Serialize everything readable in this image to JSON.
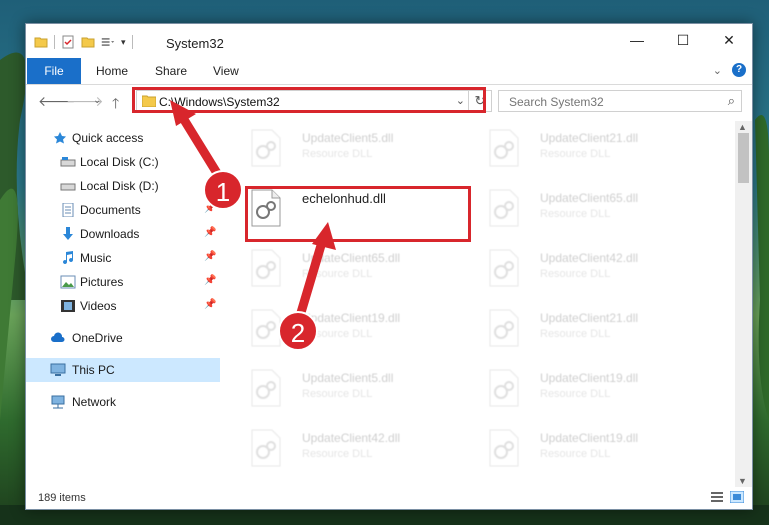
{
  "window": {
    "title": "System32",
    "controls": {
      "minimize": "—",
      "maximize": "☐",
      "close": "✕"
    }
  },
  "ribbon": {
    "tabs": [
      "File",
      "Home",
      "Share",
      "View"
    ],
    "help": "?"
  },
  "address": {
    "path": "C:\\Windows\\System32",
    "search_placeholder": "Search System32"
  },
  "sidebar": {
    "items": [
      {
        "label": "Quick access",
        "icon": "star-icon"
      },
      {
        "label": "Local Disk (C:)",
        "icon": "drive-icon"
      },
      {
        "label": "Local Disk (D:)",
        "icon": "drive-icon"
      },
      {
        "label": "Documents",
        "icon": "documents-icon",
        "pinned": true
      },
      {
        "label": "Downloads",
        "icon": "download-icon",
        "pinned": true
      },
      {
        "label": "Music",
        "icon": "music-icon",
        "pinned": true
      },
      {
        "label": "Pictures",
        "icon": "pictures-icon",
        "pinned": true
      },
      {
        "label": "Videos",
        "icon": "videos-icon",
        "pinned": true
      },
      {
        "label": "OneDrive",
        "icon": "cloud-icon"
      },
      {
        "label": "This PC",
        "icon": "computer-icon",
        "selected": true
      },
      {
        "label": "Network",
        "icon": "network-icon"
      }
    ]
  },
  "files": [
    {
      "name": "UpdateClient5.dll",
      "type": "Resource DLL"
    },
    {
      "name": "UpdateClient21.dll",
      "type": "Resource DLL"
    },
    {
      "name": "echelonhud.dll",
      "type": ""
    },
    {
      "name": "UpdateClient65.dll",
      "type": "Resource DLL"
    },
    {
      "name": "UpdateClient65.dll",
      "type": "Resource DLL"
    },
    {
      "name": "UpdateClient42.dll",
      "type": "Resource DLL"
    },
    {
      "name": "UpdateClient19.dll",
      "type": "Resource DLL"
    },
    {
      "name": "UpdateClient21.dll",
      "type": "Resource DLL"
    },
    {
      "name": "UpdateClient5.dll",
      "type": "Resource DLL"
    },
    {
      "name": "UpdateClient19.dll",
      "type": "Resource DLL"
    },
    {
      "name": "UpdateClient42.dll",
      "type": "Resource DLL"
    },
    {
      "name": "UpdateClient19.dll",
      "type": "Resource DLL"
    }
  ],
  "status": {
    "item_count": "189 items"
  },
  "annotations": {
    "step1": "1",
    "step2": "2"
  },
  "colors": {
    "accent": "#1a6fc9",
    "highlight": "#d8262c",
    "selected": "#cce8ff"
  }
}
